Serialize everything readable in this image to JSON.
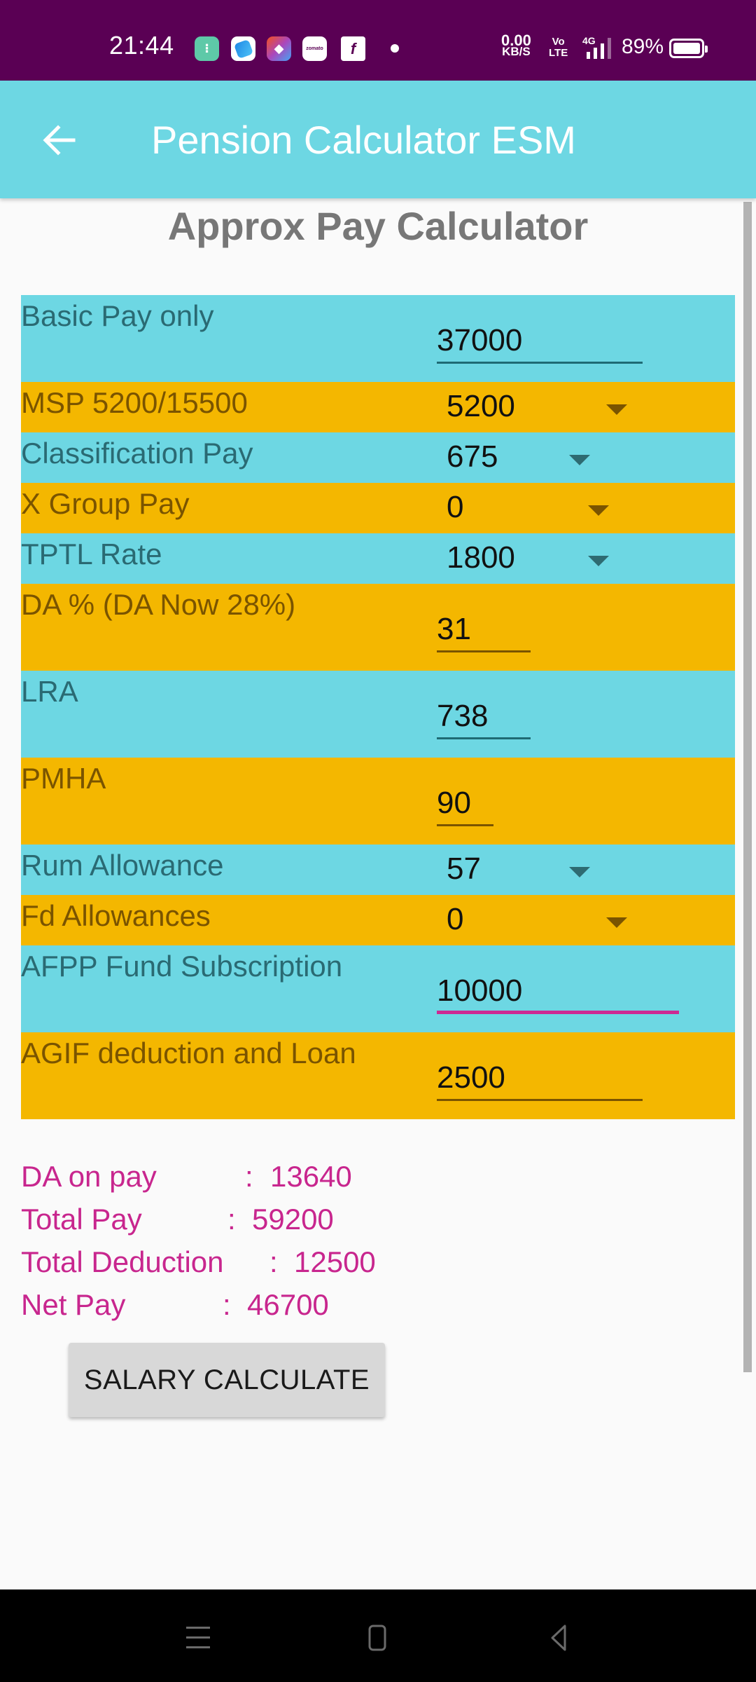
{
  "status_bar": {
    "time": "21:44",
    "notification_icons": [
      "app-icon-green",
      "app-icon-blue",
      "app-icon-gradient",
      "zomato-icon",
      "flipkart-icon"
    ],
    "zomato_label": "zomato",
    "net_speed_value": "0.00",
    "net_speed_unit": "KB/S",
    "volte_top": "Vo",
    "volte_bottom": "LTE",
    "network_type": "4G",
    "battery_percent": "89%"
  },
  "app_bar": {
    "title": "Pension Calculator ESM",
    "back_icon": "arrow-left-icon"
  },
  "page": {
    "heading": "Approx Pay Calculator"
  },
  "form": {
    "fields": [
      {
        "label": "Basic Pay only",
        "type": "input",
        "value": "37000",
        "color": "cyan"
      },
      {
        "label": "MSP 5200/15500",
        "type": "dropdown",
        "value": "5200",
        "color": "yellow"
      },
      {
        "label": "Classification Pay",
        "type": "dropdown",
        "value": "675",
        "color": "cyan"
      },
      {
        "label": "X Group Pay",
        "type": "dropdown",
        "value": "0",
        "color": "yellow"
      },
      {
        "label": "TPTL Rate",
        "type": "dropdown",
        "value": "1800",
        "color": "cyan"
      },
      {
        "label": "DA % (DA Now 28%)",
        "type": "input",
        "value": "31",
        "color": "yellow"
      },
      {
        "label": "LRA",
        "type": "input",
        "value": "738",
        "color": "cyan"
      },
      {
        "label": "PMHA",
        "type": "input",
        "value": "90",
        "color": "yellow"
      },
      {
        "label": "Rum Allowance",
        "type": "dropdown",
        "value": "57",
        "color": "cyan"
      },
      {
        "label": "Fd Allowances",
        "type": "dropdown",
        "value": "0",
        "color": "yellow"
      },
      {
        "label": "AFPP Fund Subscription",
        "type": "input",
        "value": "10000",
        "color": "cyan",
        "focused": true
      },
      {
        "label": "AGIF deduction and Loan",
        "type": "input",
        "value": "2500",
        "color": "yellow"
      }
    ]
  },
  "results": [
    {
      "label": "DA on pay",
      "separator": ":",
      "value": "13640"
    },
    {
      "label": "Total Pay",
      "separator": ":",
      "value": "59200"
    },
    {
      "label": "Total Deduction",
      "separator": ":",
      "value": "12500"
    },
    {
      "label": "Net Pay",
      "separator": ":",
      "value": "46700"
    }
  ],
  "actions": {
    "calculate_label": "SALARY CALCULATE"
  },
  "colors": {
    "status_bar_bg": "#5a0054",
    "app_bar_bg": "#6dd7e3",
    "row_cyan": "#6dd7e3",
    "row_yellow": "#f4b700",
    "result_text": "#c8268e",
    "focus_underline": "#cc2a92"
  },
  "nav_bar": {
    "buttons": [
      "recents-icon",
      "home-icon",
      "back-icon"
    ]
  }
}
